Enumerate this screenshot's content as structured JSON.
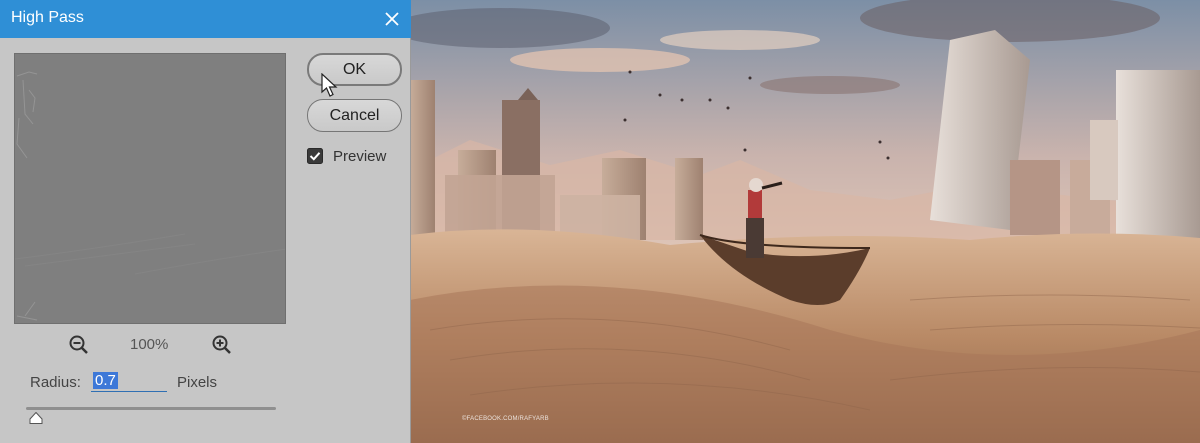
{
  "dialog": {
    "title": "High Pass",
    "close_icon": "close-icon",
    "ok_label": "OK",
    "cancel_label": "Cancel",
    "preview_label": "Preview",
    "preview_checked": true,
    "zoom_level": "100%",
    "zoom_out_icon": "zoom-out-icon",
    "zoom_in_icon": "zoom-in-icon",
    "radius_label": "Radius:",
    "radius_value": "0.7",
    "radius_units": "Pixels",
    "slider_fraction": 0.02,
    "colors": {
      "titlebar": "#2f8fd6",
      "dialog_bg": "#c6c6c6",
      "preview_gray": "#7f7f7f",
      "selection": "#3d78d8"
    }
  },
  "canvas": {
    "watermark": "©FACEBOOK.COM/RAFYARB"
  }
}
